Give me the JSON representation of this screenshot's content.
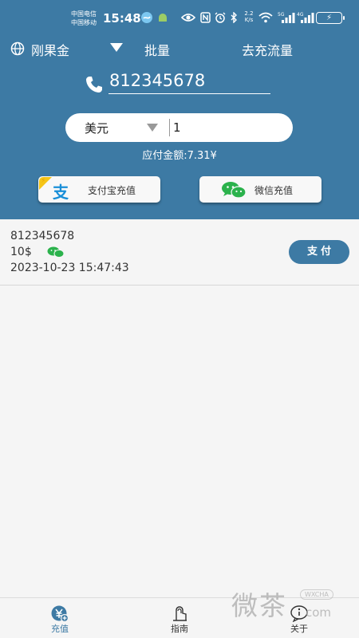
{
  "status_bar": {
    "carrier1": "中国电信",
    "carrier2": "中国移动",
    "time": "15:48",
    "network_speed": "2.2",
    "network_unit": "K/s",
    "sig1": "5G",
    "sig2": "4G"
  },
  "top_bar": {
    "operator": "刚果金",
    "batch": "批量",
    "flow": "去充流量"
  },
  "phone": {
    "value": "812345678"
  },
  "currency": {
    "selected": "美元",
    "amount": "1"
  },
  "due": {
    "text": "应付金额:7.31¥"
  },
  "pay_buttons": {
    "alipay": "支付宝充值",
    "alipay_glyph": "支",
    "wechat": "微信充值"
  },
  "order": {
    "phone": "812345678",
    "amount": "10$",
    "time": "2023-10-23 15:47:43",
    "pay_label": "支付"
  },
  "bottom_nav": {
    "items": [
      {
        "label": "充值",
        "icon": "recharge-icon",
        "active": true
      },
      {
        "label": "指南",
        "icon": "guide-icon",
        "active": false
      },
      {
        "label": "关于",
        "icon": "info-icon",
        "active": false
      }
    ]
  },
  "watermark": {
    "text": "微茶",
    "badge": "WXCHA",
    "tail": "com"
  },
  "colors": {
    "primary": "#3d7aa4",
    "wechat": "#2bb24c",
    "alipay": "#1a8fd8",
    "nav_active": "#3d7aa4",
    "nav_inactive": "#333333"
  }
}
